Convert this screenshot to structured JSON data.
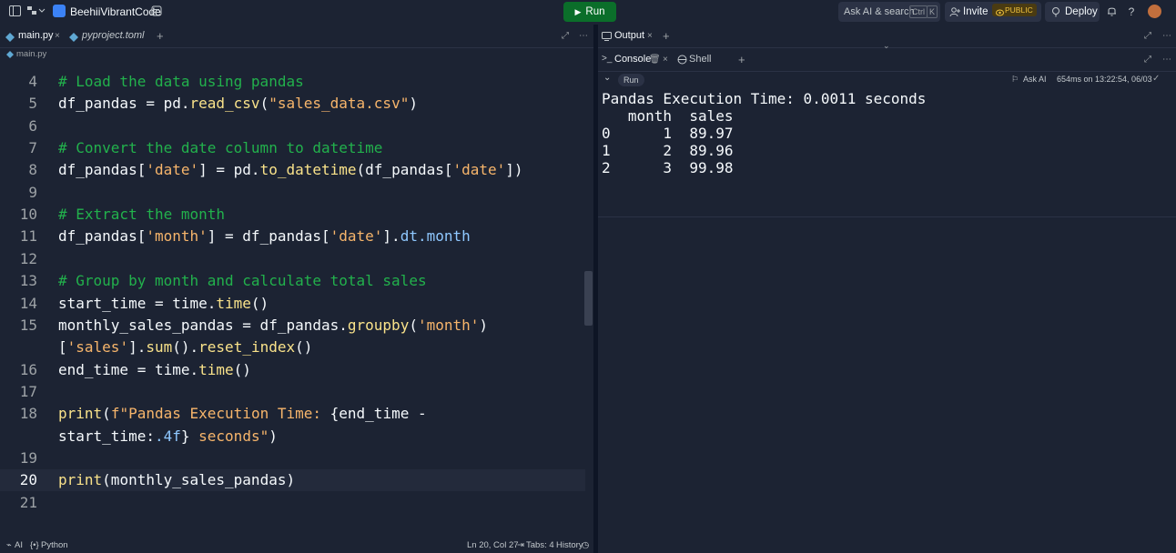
{
  "topbar": {
    "repl_name": "BeehiiVibrantCode",
    "run_label": "Run",
    "ask_ai_label": "Ask AI & search",
    "kbd_ctrl": "Ctrl",
    "kbd_k": "K",
    "invite_label": "Invite",
    "public_badge": "PUBLIC",
    "deploy_label": "Deploy"
  },
  "left": {
    "tabs": [
      {
        "label": "main.py",
        "active": true
      },
      {
        "label": "pyproject.toml",
        "active": false
      }
    ],
    "breadcrumb": "main.py",
    "status": {
      "ai": "AI",
      "language": "Python",
      "position": "Ln 20, Col 27",
      "tabs": "Tabs: 4",
      "history": "History"
    }
  },
  "code_lines": [
    {
      "n": "4",
      "segs": [
        {
          "t": "# Load the data using pandas",
          "c": "cmt"
        }
      ]
    },
    {
      "n": "5",
      "segs": [
        {
          "t": "df_pandas = pd.",
          "c": ""
        },
        {
          "t": "read_csv",
          "c": "fn"
        },
        {
          "t": "(",
          "c": ""
        },
        {
          "t": "\"sales_data.csv\"",
          "c": "str"
        },
        {
          "t": ")",
          "c": ""
        }
      ]
    },
    {
      "n": "6",
      "segs": []
    },
    {
      "n": "7",
      "segs": [
        {
          "t": "# Convert the date column to datetime",
          "c": "cmt"
        }
      ]
    },
    {
      "n": "8",
      "segs": [
        {
          "t": "df_pandas[",
          "c": ""
        },
        {
          "t": "'date'",
          "c": "str"
        },
        {
          "t": "] = pd.",
          "c": ""
        },
        {
          "t": "to_datetime",
          "c": "fn"
        },
        {
          "t": "(df_pandas[",
          "c": ""
        },
        {
          "t": "'date'",
          "c": "str"
        },
        {
          "t": "])",
          "c": ""
        }
      ]
    },
    {
      "n": "9",
      "segs": []
    },
    {
      "n": "10",
      "segs": [
        {
          "t": "# Extract the month",
          "c": "cmt"
        }
      ]
    },
    {
      "n": "11",
      "segs": [
        {
          "t": "df_pandas[",
          "c": ""
        },
        {
          "t": "'month'",
          "c": "str"
        },
        {
          "t": "] = df_pandas[",
          "c": ""
        },
        {
          "t": "'date'",
          "c": "str"
        },
        {
          "t": "].",
          "c": ""
        },
        {
          "t": "dt.month",
          "c": "attr"
        }
      ]
    },
    {
      "n": "12",
      "segs": []
    },
    {
      "n": "13",
      "segs": [
        {
          "t": "# Group by month and calculate total sales",
          "c": "cmt"
        }
      ]
    },
    {
      "n": "14",
      "segs": [
        {
          "t": "start_time = time.",
          "c": ""
        },
        {
          "t": "time",
          "c": "fn"
        },
        {
          "t": "()",
          "c": ""
        }
      ]
    },
    {
      "n": "15",
      "segs": [
        {
          "t": "monthly_sales_pandas = df_pandas.",
          "c": ""
        },
        {
          "t": "groupby",
          "c": "fn"
        },
        {
          "t": "(",
          "c": ""
        },
        {
          "t": "'month'",
          "c": "str"
        },
        {
          "t": ")",
          "c": ""
        }
      ]
    },
    {
      "n": "",
      "segs": [
        {
          "t": "[",
          "c": ""
        },
        {
          "t": "'sales'",
          "c": "str"
        },
        {
          "t": "].",
          "c": ""
        },
        {
          "t": "sum",
          "c": "fn"
        },
        {
          "t": "().",
          "c": ""
        },
        {
          "t": "reset_index",
          "c": "fn"
        },
        {
          "t": "()",
          "c": ""
        }
      ]
    },
    {
      "n": "16",
      "segs": [
        {
          "t": "end_time = time.",
          "c": ""
        },
        {
          "t": "time",
          "c": "fn"
        },
        {
          "t": "()",
          "c": ""
        }
      ]
    },
    {
      "n": "17",
      "segs": []
    },
    {
      "n": "18",
      "segs": [
        {
          "t": "print",
          "c": "fn"
        },
        {
          "t": "(",
          "c": ""
        },
        {
          "t": "f\"Pandas Execution Time: ",
          "c": "str"
        },
        {
          "t": "{end_time -",
          "c": ""
        }
      ]
    },
    {
      "n": "",
      "segs": [
        {
          "t": "start_time:",
          "c": ""
        },
        {
          "t": ".4f",
          "c": "attr"
        },
        {
          "t": "}",
          "c": ""
        },
        {
          "t": " seconds\"",
          "c": "str"
        },
        {
          "t": ")",
          "c": ""
        }
      ]
    },
    {
      "n": "19",
      "segs": []
    },
    {
      "n": "20",
      "segs": [
        {
          "t": "print",
          "c": "fn"
        },
        {
          "t": "(monthly_sales_pandas)",
          "c": ""
        }
      ],
      "current": true
    },
    {
      "n": "21",
      "segs": []
    }
  ],
  "right": {
    "top_tabs": [
      {
        "label": "Output"
      }
    ],
    "console_tabs": [
      {
        "label": "Console"
      },
      {
        "label": "Shell"
      }
    ],
    "run_chip": "Run",
    "ask_ai": "Ask AI",
    "timing": "654ms on 13:22:54, 06/03",
    "console_lines": [
      "Pandas Execution Time: 0.0011 seconds",
      "   month  sales",
      "0      1  89.97",
      "1      2  89.96",
      "2      3  99.98"
    ]
  }
}
